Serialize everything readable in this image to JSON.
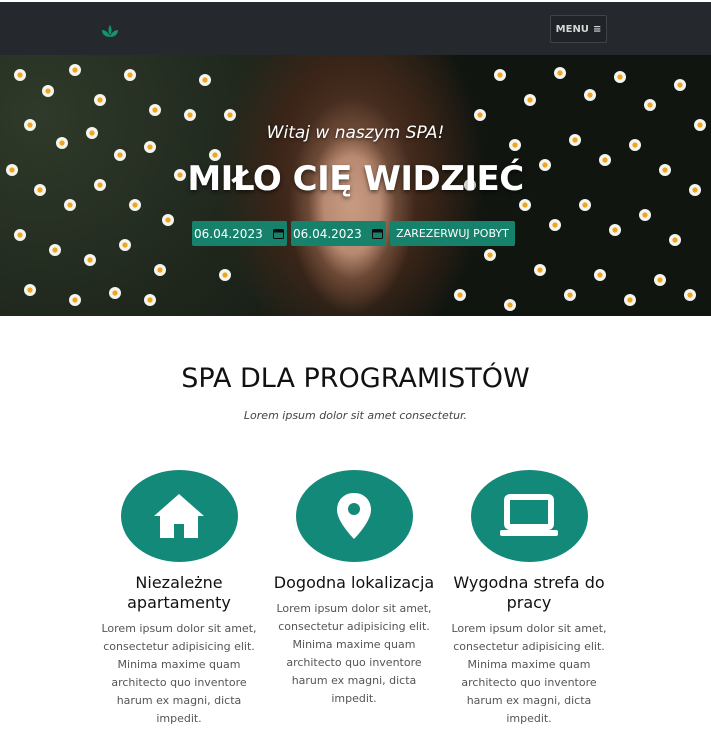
{
  "nav": {
    "logo_icon": "leaf-logo-icon",
    "menu_label": "MENU",
    "menu_icon": "hamburger-icon",
    "background": "#25282c"
  },
  "hero": {
    "welcome": "Witaj w naszym SPA!",
    "title": "MIŁO CIĘ WIDZIEĆ",
    "date_from": "06.04.2023",
    "date_to": "06.04.2023",
    "calendar_icon": "calendar-icon",
    "book_label": "ZAREZERWUJ POBYT"
  },
  "section": {
    "title": "SPA DLA PROGRAMISTÓW",
    "subtitle": "Lorem ipsum dolor sit amet consectetur."
  },
  "features": [
    {
      "icon": "house-icon",
      "title": "Niezależne apartamenty",
      "text": "Lorem ipsum dolor sit amet, consectetur adipisicing elit. Minima maxime quam architecto quo inventore harum ex magni, dicta impedit."
    },
    {
      "icon": "map-pin-icon",
      "title": "Dogodna lokalizacja",
      "text": "Lorem ipsum dolor sit amet, consectetur adipisicing elit. Minima maxime quam architecto quo inventore harum ex magni, dicta impedit."
    },
    {
      "icon": "laptop-icon",
      "title": "Wygodna strefa do pracy",
      "text": "Lorem ipsum dolor sit amet, consectetur adipisicing elit. Minima maxime quam architecto quo inventore harum ex magni, dicta impedit."
    }
  ],
  "colors": {
    "accent": "#13897a",
    "button": "#16826b"
  }
}
